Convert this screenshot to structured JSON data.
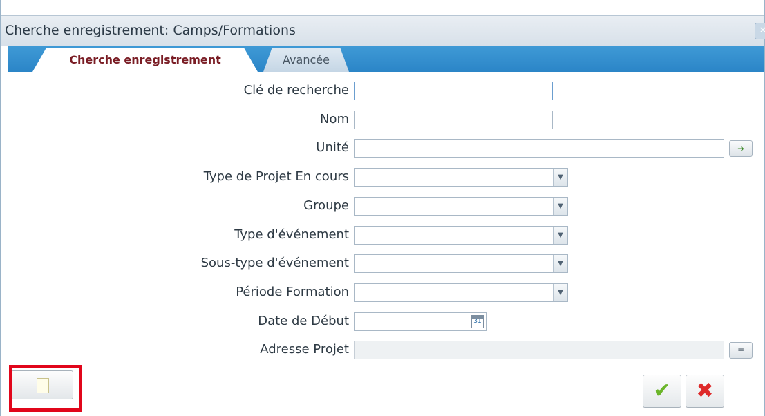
{
  "dialog": {
    "title": "Cherche enregistrement: Camps/Formations",
    "close_icon": "close-icon",
    "tabs": [
      {
        "label": "Cherche enregistrement",
        "active": true
      },
      {
        "label": "Avancée",
        "active": false
      }
    ]
  },
  "form": {
    "fields": [
      {
        "label": "Clé de recherche",
        "type": "text",
        "value": ""
      },
      {
        "label": "Nom",
        "type": "text",
        "value": ""
      },
      {
        "label": "Unité",
        "type": "text-lookup",
        "value": ""
      },
      {
        "label": "Type de Projet En cours",
        "type": "select",
        "value": ""
      },
      {
        "label": "Groupe",
        "type": "select",
        "value": ""
      },
      {
        "label": "Type d'événement",
        "type": "select",
        "value": ""
      },
      {
        "label": "Sous-type d'événement",
        "type": "select",
        "value": ""
      },
      {
        "label": "Période Formation",
        "type": "select",
        "value": ""
      },
      {
        "label": "Date de Début",
        "type": "date",
        "value": "",
        "calendar_day": "31"
      },
      {
        "label": "Adresse Projet",
        "type": "address",
        "value": "",
        "disabled": true
      }
    ]
  },
  "footer": {
    "new_icon": "new-document-icon",
    "ok_icon": "checkmark-icon",
    "cancel_icon": "x-icon",
    "highlight_color": "#e1061b"
  },
  "colors": {
    "tab_strip": "#2b85c7",
    "active_tab_text": "#7a1d25"
  }
}
